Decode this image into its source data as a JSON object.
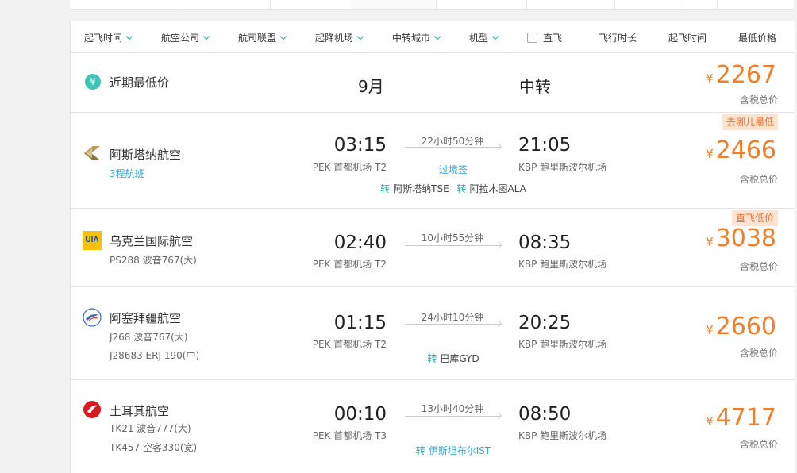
{
  "filters": [
    {
      "label": "起飞时间",
      "dropdown": true
    },
    {
      "label": "航空公司",
      "dropdown": true
    },
    {
      "label": "航司联盟",
      "dropdown": true
    },
    {
      "label": "起降机场",
      "dropdown": true
    },
    {
      "label": "中转城市",
      "dropdown": true
    },
    {
      "label": "机型",
      "dropdown": true
    }
  ],
  "direct_label": "直飞",
  "sorts": [
    "飞行时长",
    "起飞时间",
    "最低价格"
  ],
  "summary": {
    "icon": "yen-icon",
    "icon_glyph": "¥",
    "label": "近期最低价",
    "month": "9月",
    "transfer": "中转",
    "price_symbol": "¥",
    "price": "2267",
    "tax_label": "含税总价"
  },
  "flights": [
    {
      "airline": "阿斯塔纳航空",
      "logo": "air-astana-logo",
      "sub1": "3程航班",
      "sub1_link": true,
      "sub2": "",
      "dep_time": "03:15",
      "dep_airport": "PEK 首都机场 T2",
      "duration": "22小时50分钟",
      "middle_note": "过境签",
      "transfers": [
        {
          "icon": "转",
          "city": "阿斯塔纳TSE"
        },
        {
          "icon": "转",
          "city": "阿拉木图ALA"
        }
      ],
      "arr_time": "21:05",
      "arr_airport": "KBP 鲍里斯波尔机场",
      "price_symbol": "¥",
      "price": "2466",
      "tax_label": "含税总价",
      "tag": "去哪儿最低"
    },
    {
      "airline": "乌克兰国际航空",
      "logo": "uia-logo",
      "logo_text": "UIA",
      "sub1": "PS288 波音767(大)",
      "sub1_link": false,
      "sub2": "",
      "dep_time": "02:40",
      "dep_airport": "PEK 首都机场 T2",
      "duration": "10小时55分钟",
      "middle_note": "",
      "transfers": [],
      "arr_time": "08:35",
      "arr_airport": "KBP 鲍里斯波尔机场",
      "price_symbol": "¥",
      "price": "3038",
      "tax_label": "含税总价",
      "tag": "直飞低价"
    },
    {
      "airline": "阿塞拜疆航空",
      "logo": "azal-logo",
      "sub1": "J268 波音767(大)",
      "sub1_link": false,
      "sub2": "J28683 ERJ-190(中)",
      "dep_time": "01:15",
      "dep_airport": "PEK 首都机场 T2",
      "duration": "24小时10分钟",
      "middle_note": "",
      "transfers": [
        {
          "icon": "转",
          "city": "巴库GYD"
        }
      ],
      "arr_time": "20:25",
      "arr_airport": "KBP 鲍里斯波尔机场",
      "price_symbol": "¥",
      "price": "2660",
      "tax_label": "含税总价",
      "tag": ""
    },
    {
      "airline": "土耳其航空",
      "logo": "turkish-airlines-logo",
      "sub1": "TK21 波音777(大)",
      "sub1_link": false,
      "sub2": "TK457 空客330(宽)",
      "dep_time": "00:10",
      "dep_airport": "PEK 首都机场 T3",
      "duration": "13小时40分钟",
      "middle_note": "",
      "transfers": [
        {
          "icon": "转",
          "city": "伊斯坦布尔IST"
        }
      ],
      "arr_time": "08:50",
      "arr_airport": "KBP 鲍里斯波尔机场",
      "price_symbol": "¥",
      "price": "4717",
      "tax_label": "含税总价",
      "tag": ""
    }
  ],
  "colors": {
    "accent": "#2aa9a3",
    "price": "#f07e2b",
    "link": "#3aa7d6",
    "tag_bg": "#fde3d1"
  }
}
